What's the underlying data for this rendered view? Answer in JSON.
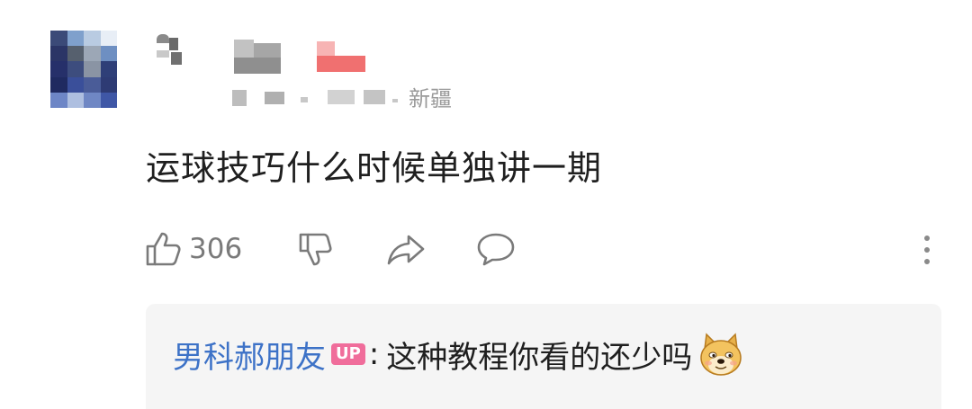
{
  "comment": {
    "location": "新疆",
    "text": "运球技巧什么时候单独讲一期",
    "like_count": "306",
    "icons": {
      "like": "thumbs-up-icon",
      "dislike": "thumbs-down-icon",
      "share": "share-icon",
      "reply": "chat-bubble-icon",
      "more": "more-vertical-icon"
    }
  },
  "reply": {
    "author": "男科郝朋友",
    "badge": "UP",
    "separator": ":",
    "text": "这种教程你看的还少吗",
    "emoji": "doge-emoji-icon"
  },
  "colors": {
    "author_link": "#3d72c7",
    "up_badge": "#f06d9b",
    "reply_bg": "#f5f5f5",
    "icon_gray": "#7a7a7a"
  }
}
